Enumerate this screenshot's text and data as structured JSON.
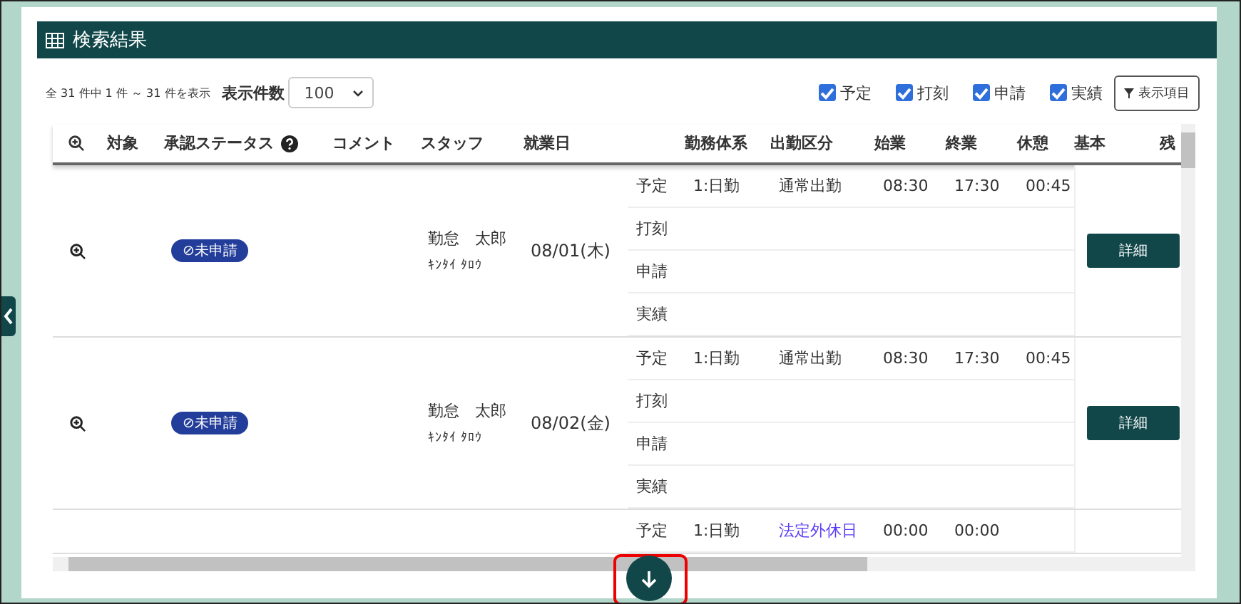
{
  "header": {
    "title": "検索結果"
  },
  "summary": "全 31 件中 1 件 ～ 31 件を表示",
  "page_size": {
    "label": "表示件数",
    "value": "100"
  },
  "filters": [
    {
      "label": "予定",
      "checked": true
    },
    {
      "label": "打刻",
      "checked": true
    },
    {
      "label": "申請",
      "checked": true
    },
    {
      "label": "実績",
      "checked": true
    }
  ],
  "columns_button": "表示項目",
  "table": {
    "columns": [
      "対象",
      "承認ステータス",
      "コメント",
      "スタッフ",
      "就業日",
      "勤務体系",
      "出勤区分",
      "始業",
      "終業",
      "休憩",
      "基本",
      "残"
    ],
    "records": [
      {
        "status": "⊘未申請",
        "staff_name": "勤怠　太郎",
        "staff_kana": "ｷﾝﾀｲ ﾀﾛｳ",
        "date": "08/01(木)",
        "detail_button": "詳細",
        "lines": [
          {
            "type": "予定",
            "work_system": "1:日勤",
            "attendance": "通常出勤",
            "color": "#333333",
            "start": "08:30",
            "end": "17:30",
            "break": "00:45"
          },
          {
            "type": "打刻"
          },
          {
            "type": "申請"
          },
          {
            "type": "実績"
          }
        ]
      },
      {
        "status": "⊘未申請",
        "staff_name": "勤怠　太郎",
        "staff_kana": "ｷﾝﾀｲ ﾀﾛｳ",
        "date": "08/02(金)",
        "detail_button": "詳細",
        "lines": [
          {
            "type": "予定",
            "work_system": "1:日勤",
            "attendance": "通常出勤",
            "color": "#333333",
            "start": "08:30",
            "end": "17:30",
            "break": "00:45"
          },
          {
            "type": "打刻"
          },
          {
            "type": "申請"
          },
          {
            "type": "実績"
          }
        ]
      },
      {
        "lines": [
          {
            "type": "予定",
            "work_system": "1:日勤",
            "attendance": "法定外休日",
            "color": "#5b3cf5",
            "start": "00:00",
            "end": "00:00"
          }
        ]
      }
    ]
  }
}
